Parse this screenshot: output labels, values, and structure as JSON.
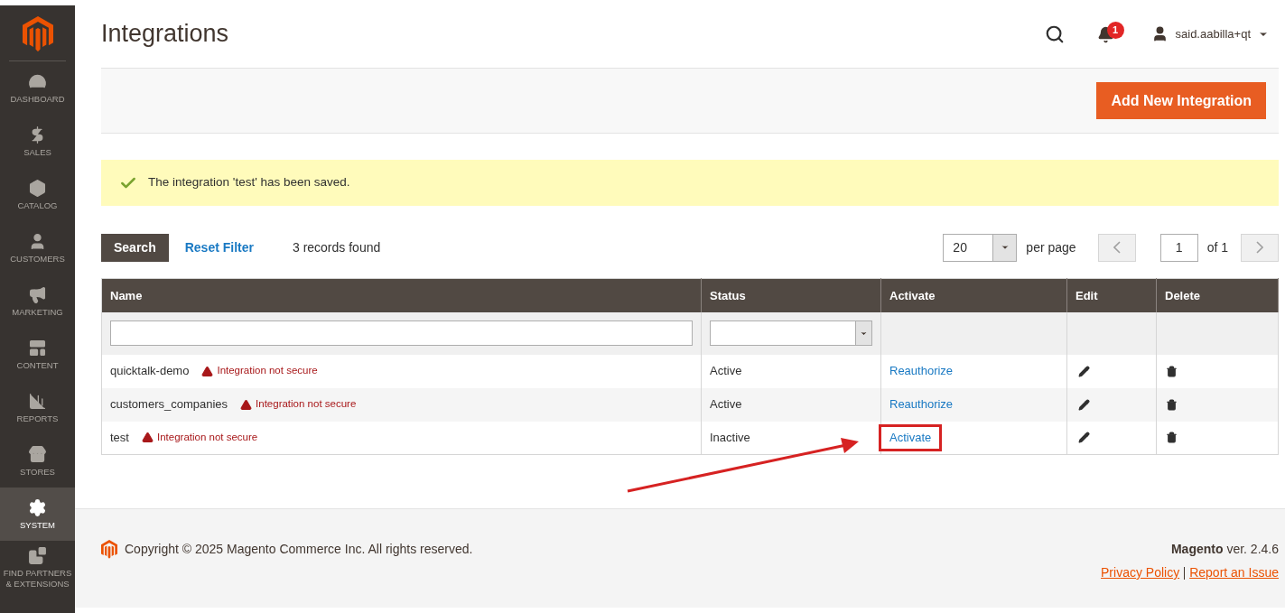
{
  "sidebar": {
    "items": [
      {
        "label": "DASHBOARD",
        "selected": false
      },
      {
        "label": "SALES",
        "selected": false
      },
      {
        "label": "CATALOG",
        "selected": false
      },
      {
        "label": "CUSTOMERS",
        "selected": false
      },
      {
        "label": "MARKETING",
        "selected": false
      },
      {
        "label": "CONTENT",
        "selected": false
      },
      {
        "label": "REPORTS",
        "selected": false
      },
      {
        "label": "STORES",
        "selected": false
      },
      {
        "label": "SYSTEM",
        "selected": true
      },
      {
        "label": "FIND PARTNERS & EXTENSIONS",
        "selected": false
      }
    ]
  },
  "header": {
    "title": "Integrations",
    "notifications": "1",
    "user": "said.aabilla+qt"
  },
  "actions": {
    "primary": "Add New Integration"
  },
  "message": "The integration 'test' has been saved.",
  "toolbar": {
    "search": "Search",
    "reset": "Reset Filter",
    "records": "3 records found",
    "per_page_value": "20",
    "per_page_label": "per page",
    "page": "1",
    "of": "of 1"
  },
  "table": {
    "columns": [
      "Name",
      "Status",
      "Activate",
      "Edit",
      "Delete"
    ],
    "rows": [
      {
        "name": "quicktalk-demo",
        "warning": "Integration not secure",
        "status": "Active",
        "activate": "Reauthorize",
        "highlighted": false
      },
      {
        "name": "customers_companies",
        "warning": "Integration not secure",
        "status": "Active",
        "activate": "Reauthorize",
        "highlighted": false
      },
      {
        "name": "test",
        "warning": "Integration not secure",
        "status": "Inactive",
        "activate": "Activate",
        "highlighted": true
      }
    ]
  },
  "footer": {
    "copyright": "Copyright © 2025 Magento Commerce Inc. All rights reserved.",
    "version": "**Magento** ver. 2.4.6",
    "links": [
      "Privacy Policy",
      "Report an Issue"
    ]
  }
}
